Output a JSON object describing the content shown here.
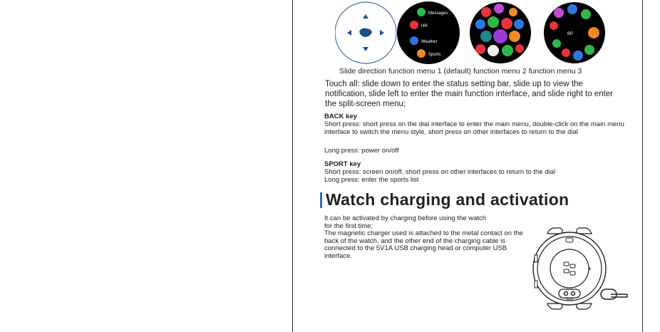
{
  "menu_icons": {
    "menu1_labels": [
      "Messages",
      "HR",
      "Weather",
      "Sports"
    ],
    "menu3_center_label": "BP"
  },
  "caption": "Slide direction function menu 1 (default) function menu 2 function menu 3",
  "touch_all": "Touch all: slide down to enter the status setting bar, slide up to view the notification, slide left to enter the main function interface, and slide right to enter the split-screen menu;",
  "back_key": {
    "title": "BACK key",
    "short": "Short press: short press on the dial interface to enter the main menu, double-click on the main menu interface to switch the menu style, short press on other interfaces to return to the dial",
    "long": "Long press: power on/off"
  },
  "sport_key": {
    "title": "SPORT key",
    "short": "Short press: screen on/off, short press on other interfaces to return to the dial",
    "long": "Long press: enter the sports list"
  },
  "section": {
    "title": "Watch charging and activation",
    "accent_color": "#2e6cc7"
  },
  "charging": {
    "line1": "It can be activated by charging before using the watch",
    "line2": " for the first time;",
    "body": "The magnetic charger used is attached to the metal contact on the back of the watch, and the other end of the charging cable is connected to the 5V1A USB charging head or computer USB interface."
  }
}
